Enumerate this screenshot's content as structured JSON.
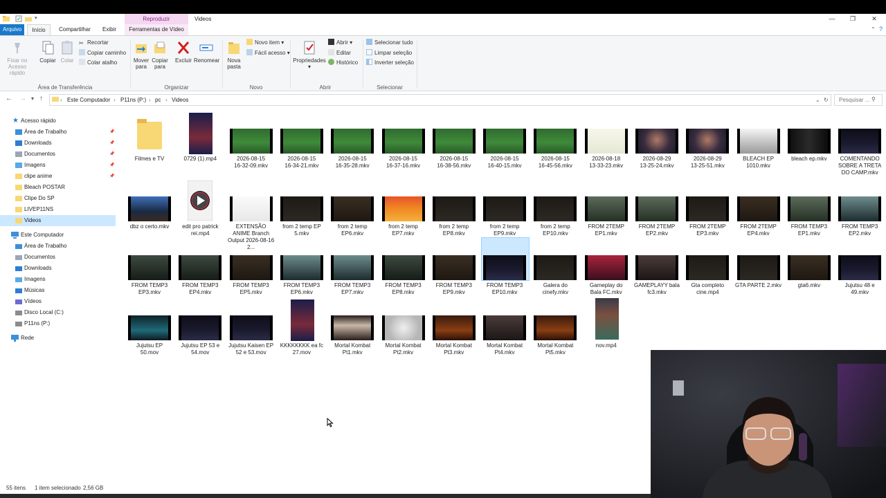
{
  "window": {
    "title": "Videos",
    "context_tab": "Reproduzir",
    "controls": [
      "minimize-icon",
      "maximize-icon",
      "close-icon"
    ]
  },
  "tabs": [
    "Arquivo",
    "Início",
    "Compartilhar",
    "Exibir",
    "Ferramentas de Vídeo"
  ],
  "ribbon": {
    "clipboard": {
      "pin_label": "Fixar no Acesso rápido",
      "copy_label": "Copiar",
      "paste_label": "Colar",
      "cut_label": "Recortar",
      "copy_path_label": "Copiar caminho",
      "paste_shortcut_label": "Colar atalho",
      "group_label": "Área de Transferência"
    },
    "organize": {
      "move_label": "Mover para",
      "copyto_label": "Copiar para",
      "delete_label": "Excluir",
      "rename_label": "Renomear",
      "group_label": "Organizar"
    },
    "new": {
      "newfolder_label": "Nova pasta",
      "newitem_label": "Novo item",
      "easyaccess_label": "Fácil acesso",
      "group_label": "Novo"
    },
    "open": {
      "properties_label": "Propriedades",
      "open_label": "Abrir",
      "edit_label": "Editar",
      "history_label": "Histórico",
      "group_label": "Abrir"
    },
    "select": {
      "selectall_label": "Selecionar tudo",
      "selectnone_label": "Limpar seleção",
      "invert_label": "Inverter seleção",
      "group_label": "Selecionar"
    }
  },
  "address": {
    "segments": [
      "Este Computador",
      "P11ns (P:)",
      "pc",
      "Videos"
    ],
    "search_placeholder": "Pesquisar ..."
  },
  "navpane": {
    "quick_access": "Acesso rápido",
    "quick_items": [
      {
        "label": "Área de Trabalho",
        "pinned": true
      },
      {
        "label": "Downloads",
        "pinned": true
      },
      {
        "label": "Documentos",
        "pinned": true
      },
      {
        "label": "Imagens",
        "pinned": true
      },
      {
        "label": "clipe anime",
        "pinned": true
      },
      {
        "label": "Bleach POSTAR",
        "pinned": false
      },
      {
        "label": "Clipe Do SP",
        "pinned": false
      },
      {
        "label": "LIVEP11NS",
        "pinned": false
      },
      {
        "label": "Videos",
        "pinned": false
      }
    ],
    "this_pc": "Este Computador",
    "pc_items": [
      "Área de Trabalho",
      "Documentos",
      "Downloads",
      "Imagens",
      "Músicas",
      "Vídeos",
      "Disco Local (C:)",
      "P11ns (P:)"
    ],
    "network": "Rede"
  },
  "files": [
    {
      "line1": "Filmes e TV",
      "line2": "",
      "line3": "",
      "kind": "folder"
    },
    {
      "line1": "0729 (1).mp4",
      "line2": "",
      "line3": "",
      "kind": "portrait"
    },
    {
      "line1": "2026-08-15",
      "line2": "16-32-09.mkv",
      "line3": "",
      "kind": "soccer"
    },
    {
      "line1": "2026-08-15",
      "line2": "16-34-21.mkv",
      "line3": "",
      "kind": "soccer"
    },
    {
      "line1": "2026-08-15",
      "line2": "16-35-28.mkv",
      "line3": "",
      "kind": "soccer"
    },
    {
      "line1": "2026-08-15",
      "line2": "16-37-16.mkv",
      "line3": "",
      "kind": "soccer"
    },
    {
      "line1": "2026-08-15",
      "line2": "16-38-56.mkv",
      "line3": "",
      "kind": "soccer"
    },
    {
      "line1": "2026-08-15",
      "line2": "16-40-15.mkv",
      "line3": "",
      "kind": "soccer"
    },
    {
      "line1": "2026-08-15",
      "line2": "16-45-56.mkv",
      "line3": "",
      "kind": "soccer"
    },
    {
      "line1": "2026-08-18",
      "line2": "13-33-23.mkv",
      "line3": "",
      "kind": "light"
    },
    {
      "line1": "2026-08-29",
      "line2": "13-25-24.mkv",
      "line3": "",
      "kind": "face"
    },
    {
      "line1": "2026-08-29",
      "line2": "13-25-51.mkv",
      "line3": "",
      "kind": "face"
    },
    {
      "line1": "BLEACH EP",
      "line2": "1010.mkv",
      "line3": "",
      "kind": "grey"
    },
    {
      "line1": "bleach ep.mkv",
      "line2": "",
      "line3": "",
      "kind": "poster"
    },
    {
      "line1": "COMENTANDO",
      "line2": "SOBRE A TRETA",
      "line3": "DO CAMP.mkv",
      "kind": "screen"
    },
    {
      "line1": "dbz o certo.mkv",
      "line2": "",
      "line3": "",
      "kind": "anime"
    },
    {
      "line1": "edit pro patrick",
      "line2": "rei.mp4",
      "line3": "",
      "kind": "play"
    },
    {
      "line1": "EXTENSÃO",
      "line2": "ANIME Branch",
      "line3": "Output 2026-08-16 2...",
      "kind": "white"
    },
    {
      "line1": "from 2 temp EP",
      "line2": "5.mkv",
      "line3": "",
      "kind": "dark"
    },
    {
      "line1": "from 2 temp",
      "line2": "EP6.mkv",
      "line3": "",
      "kind": "brown"
    },
    {
      "line1": "from 2 temp",
      "line2": "EP7.mkv",
      "line3": "",
      "kind": "orange"
    },
    {
      "line1": "from 2 temp",
      "line2": "EP8.mkv",
      "line3": "",
      "kind": "dark"
    },
    {
      "line1": "from 2 temp",
      "line2": "EP9.mkv",
      "line3": "",
      "kind": "dark"
    },
    {
      "line1": "from 2 temp",
      "line2": "EP10.mkv",
      "line3": "",
      "kind": "dark"
    },
    {
      "line1": "FROM 2TEMP",
      "line2": "EP1.mkv",
      "line3": "",
      "kind": "greenish"
    },
    {
      "line1": "FROM 2TEMP",
      "line2": "EP2.mkv",
      "line3": "",
      "kind": "greenish"
    },
    {
      "line1": "FROM 2TEMP",
      "line2": "EP3.mkv",
      "line3": "",
      "kind": "dark"
    },
    {
      "line1": "FROM 2TEMP",
      "line2": "EP4.mkv",
      "line3": "",
      "kind": "brown"
    },
    {
      "line1": "FROM TEMP3",
      "line2": "EP1.mkv",
      "line3": "",
      "kind": "greenish"
    },
    {
      "line1": "FROM TEMP3",
      "line2": "EP2.mkv",
      "line3": "",
      "kind": "teal"
    },
    {
      "line1": "FROM TEMP3",
      "line2": "EP3.mkv",
      "line3": "",
      "kind": "forest"
    },
    {
      "line1": "FROM TEMP3",
      "line2": "EP4.mkv",
      "line3": "",
      "kind": "forest"
    },
    {
      "line1": "FROM TEMP3",
      "line2": "EP5.mkv",
      "line3": "",
      "kind": "brown"
    },
    {
      "line1": "FROM TEMP3",
      "line2": "EP6.mkv",
      "line3": "",
      "kind": "teal"
    },
    {
      "line1": "FROM TEMP3",
      "line2": "EP7.mkv",
      "line3": "",
      "kind": "teal"
    },
    {
      "line1": "FROM TEMP3",
      "line2": "EP8.mkv",
      "line3": "",
      "kind": "forest"
    },
    {
      "line1": "FROM TEMP3",
      "line2": "EP9.mkv",
      "line3": "",
      "kind": "brown"
    },
    {
      "line1": "FROM TEMP3",
      "line2": "EP10.mkv",
      "line3": "",
      "kind": "screen",
      "selected": true
    },
    {
      "line1": "Galera do",
      "line2": "cinefy.mkv",
      "line3": "",
      "kind": "dark"
    },
    {
      "line1": "Gameplay do",
      "line2": "Bala FC.mkv",
      "line3": "",
      "kind": "red"
    },
    {
      "line1": "GAMEPLAYY bala",
      "line2": "fc3.mkv",
      "line3": "",
      "kind": "crowd"
    },
    {
      "line1": "Gta completo",
      "line2": "cine.mp4",
      "line3": "",
      "kind": "dark"
    },
    {
      "line1": "GTA PARTE 2.mkv",
      "line2": "",
      "line3": "",
      "kind": "dark"
    },
    {
      "line1": "gta6.mkv",
      "line2": "",
      "line3": "",
      "kind": "brown"
    },
    {
      "line1": "Jujutsu 48 e",
      "line2": "49.mkv",
      "line3": "",
      "kind": "screen"
    },
    {
      "line1": "Jujutsu EP",
      "line2": "50.mov",
      "line3": "",
      "kind": "cyan"
    },
    {
      "line1": "Jujutsu EP 53 e",
      "line2": "54.mov",
      "line3": "",
      "kind": "screen"
    },
    {
      "line1": "Jujutsu Kaisen EP",
      "line2": "52 e 53.mov",
      "line3": "",
      "kind": "screen"
    },
    {
      "line1": "KKKKKKKK ea fc",
      "line2": "27.mov",
      "line3": "",
      "kind": "portrait"
    },
    {
      "line1": "Mortal Kombat",
      "line2": "Pt1.mkv",
      "line3": "",
      "kind": "paper"
    },
    {
      "line1": "Mortal Kombat",
      "line2": "Pt2.mkv",
      "line3": "",
      "kind": "logo"
    },
    {
      "line1": "Mortal Kombat",
      "line2": "Pt3.mkv",
      "line3": "",
      "kind": "fire"
    },
    {
      "line1": "Mortal Kombat",
      "line2": "Pt4.mkv",
      "line3": "",
      "kind": "crowd"
    },
    {
      "line1": "Mortal Kombat",
      "line2": "Pt5.mkv",
      "line3": "",
      "kind": "fire"
    },
    {
      "line1": "nov.mp4",
      "line2": "",
      "line3": "",
      "kind": "portrait2"
    }
  ],
  "status": {
    "count": "55 itens",
    "selection": "1 item selecionado",
    "size": "2,56 GB"
  },
  "colors": {
    "accent": "#1979ca",
    "selection_bg": "#cce8ff",
    "selection_border": "#99d1ff",
    "context_tab": "#f4d7f1",
    "folder": "#f8d775"
  }
}
